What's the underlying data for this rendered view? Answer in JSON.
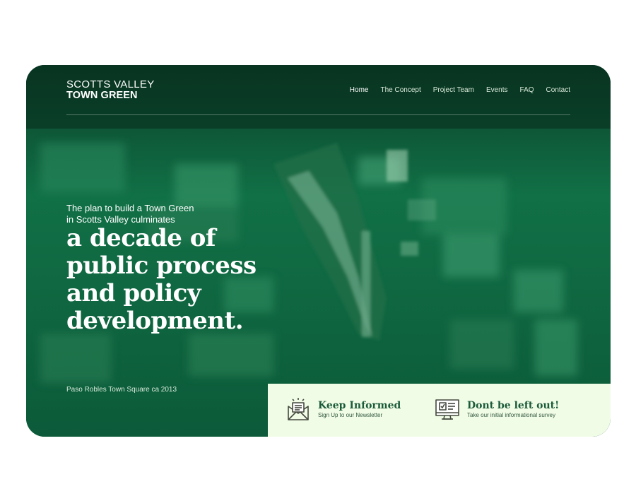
{
  "logo": {
    "line1": "SCOTTS VALLEY",
    "line2": "TOWN GREEN"
  },
  "nav": {
    "items": [
      {
        "label": "Home"
      },
      {
        "label": "The Concept"
      },
      {
        "label": "Project Team"
      },
      {
        "label": "Events"
      },
      {
        "label": "FAQ"
      },
      {
        "label": "Contact"
      }
    ],
    "active": "Home"
  },
  "hero": {
    "intro_line1": "The plan to build a Town Green",
    "intro_line2": "in Scotts Valley culminates",
    "headline_line1": "a decade of",
    "headline_line2": "public process",
    "headline_line3": "and policy",
    "headline_line4": "development.",
    "caption": "Paso Robles Town Square ca 2013"
  },
  "cta": {
    "newsletter": {
      "title": "Keep Informed",
      "subtitle": "Sign Up to our Newsletter",
      "icon": "envelope-newsletter-icon"
    },
    "survey": {
      "title": "Dont be left out!",
      "subtitle": "Take our initial informational survey",
      "icon": "computer-survey-icon"
    }
  },
  "colors": {
    "overlay_green": "#0f5a3b",
    "panel_bg": "#f1fce6",
    "cta_title": "#1b5b3a"
  }
}
